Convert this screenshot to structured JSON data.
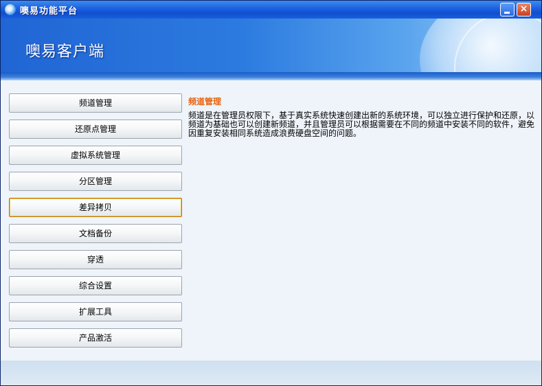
{
  "window": {
    "title": "噢易功能平台",
    "close_glyph": "×",
    "icons": {
      "app": "app-globe-icon",
      "minimize": "minimize-icon",
      "close": "close-icon"
    }
  },
  "banner": {
    "title": "噢易客户端"
  },
  "nav": {
    "items": [
      {
        "label": "频道管理"
      },
      {
        "label": "还原点管理"
      },
      {
        "label": "虚拟系统管理"
      },
      {
        "label": "分区管理"
      },
      {
        "label": "差异拷贝"
      },
      {
        "label": "文档备份"
      },
      {
        "label": "穿透"
      },
      {
        "label": "综合设置"
      },
      {
        "label": "扩展工具"
      },
      {
        "label": "产品激活"
      }
    ],
    "selected": "差异拷贝"
  },
  "content": {
    "title": "频道管理",
    "text": "频道是在管理员权限下，基于真实系统快速创建出新的系统环境，可以独立进行保护和还原，以频道为基础也可以创建新频道，并且管理员可以根据需要在不同的频道中安装不同的软件，避免因重复安装相同系统造成浪费硬盘空间的问题。"
  },
  "colors": {
    "title_bar": "#1b5fe0",
    "content_title": "#e8620c",
    "active_border": "#b8770c"
  }
}
